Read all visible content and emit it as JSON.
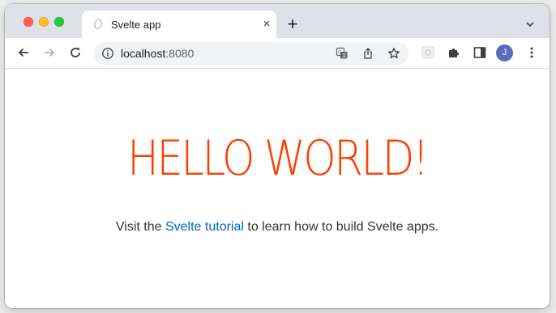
{
  "colors": {
    "accent": "#ff3e00",
    "link": "#0064c8",
    "tabstrip": "#dee1e6",
    "profile": "#5c6bc0"
  },
  "tab": {
    "title": "Svelte app",
    "favicon_icon": "svelte-logo-icon",
    "close_label": "×"
  },
  "new_tab_label": "+",
  "toolbar": {
    "icons": [
      "back-arrow-icon",
      "forward-arrow-icon",
      "reload-icon",
      "info-icon",
      "translate-icon",
      "share-icon",
      "bookmark-star-icon",
      "extension-icon",
      "puzzle-extensions-icon",
      "side-panel-icon",
      "kebab-menu-icon"
    ],
    "url_host": "localhost",
    "url_port": ":8080",
    "profile_initial": "J"
  },
  "page": {
    "heading": "HELLO WORLD!",
    "text_before": "Visit the ",
    "link_text": "Svelte tutorial",
    "text_after": " to learn how to build Svelte apps."
  }
}
